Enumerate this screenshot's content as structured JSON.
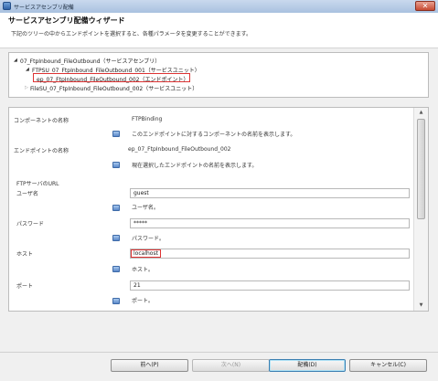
{
  "window": {
    "title": "サービスアセンブリ配備"
  },
  "header": {
    "title": "サービスアセンブリ配備ウィザード",
    "subtitle": "下記のツリーの中からエンドポイントを選択すると、各種パラメータを変更することができます。"
  },
  "tree": {
    "root": "07_FtpInbound_FileOutbound（サービスアセンブリ）",
    "unit1": "FTPSU_07_FtpInbound_FileOutbound_001（サービスユニット）",
    "endpoint": "ep_07_FtpInbound_FileOutbound_002（エンドポイント）",
    "unit2": "FileSU_07_FtpInbound_FileOutbound_002（サービスユニット）"
  },
  "properties": {
    "component_label": "コンポーネントの名称",
    "component_value": "FTPBinding",
    "component_desc": "このエンドポイントに対するコンポーネントの名前を表示します。",
    "endpoint_label": "エンドポイントの名称",
    "endpoint_value": "ep_07_FtpInbound_FileOutbound_002",
    "endpoint_desc": "現在選択したエンドポイントの名前を表示します。",
    "group_label": "FTPサーバのURL",
    "user_label": "ユーザ名",
    "user_value": "guest",
    "user_desc": "ユーザ名。",
    "password_label": "パスワード",
    "password_value": "*****",
    "password_desc": "パスワード。",
    "host_label": "ホスト",
    "host_value": "localhost",
    "host_desc": "ホスト。",
    "port_label": "ポート",
    "port_value": "21",
    "port_desc": "ポート。"
  },
  "buttons": {
    "back": "前へ(P)",
    "next": "次へ(N)",
    "deploy": "配備(D)",
    "cancel": "キャンセル(C)"
  },
  "icons": {
    "window": "app-icon",
    "close": "close-icon",
    "info": "info-book-icon"
  }
}
